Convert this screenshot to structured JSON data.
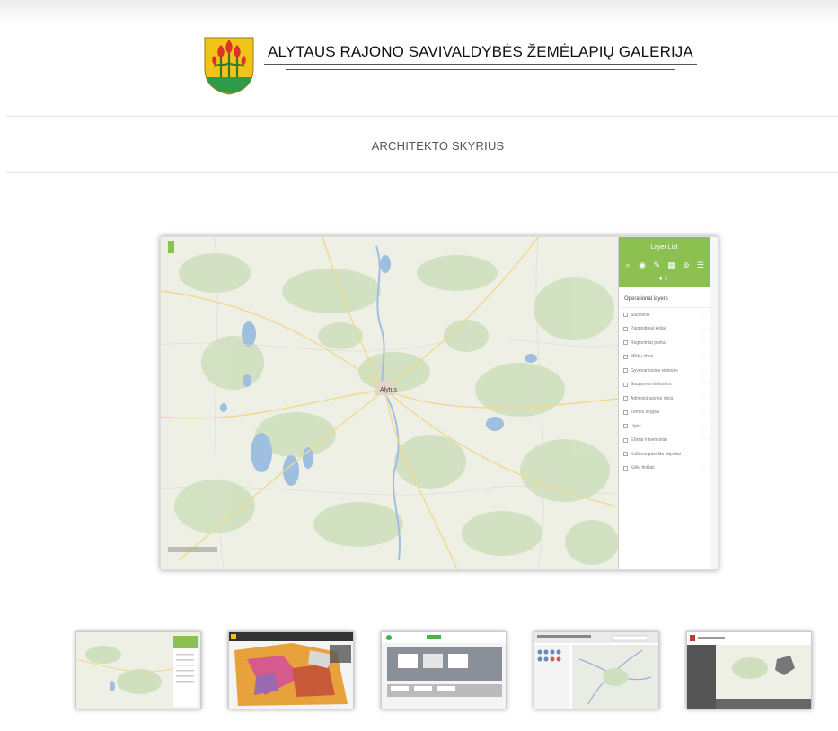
{
  "header": {
    "title": "ALYTAUS RAJONO SAVIVALDYBĖS ŽEMĖLAPIŲ GALERIJA",
    "logo": "alytus-district-coat-of-arms"
  },
  "section": {
    "title": "ARCHITEKTO SKYRIUS"
  },
  "viewer": {
    "panel_title": "Layer List",
    "panel_subtitle": "Operational layers",
    "city_label": "Alytus",
    "layers": [
      "Sluoksnis",
      "Pagrindiniai keliai",
      "Regioniniai parkai",
      "Miškų ribos",
      "Gyvenamosios vietovės",
      "Saugomos teritorijos",
      "Administracinės ribos",
      "Žemės sklypai",
      "Upės",
      "Ežerai ir tvenkiniai",
      "Kultūros paveldo objektai",
      "Kelių tinklas"
    ],
    "accent_color": "#8cc152"
  },
  "thumbnails": [
    {
      "name": "thumb-layer-list-map"
    },
    {
      "name": "thumb-zoning-map"
    },
    {
      "name": "thumb-dashboard"
    },
    {
      "name": "thumb-road-map-app"
    },
    {
      "name": "thumb-web-viewer"
    }
  ]
}
